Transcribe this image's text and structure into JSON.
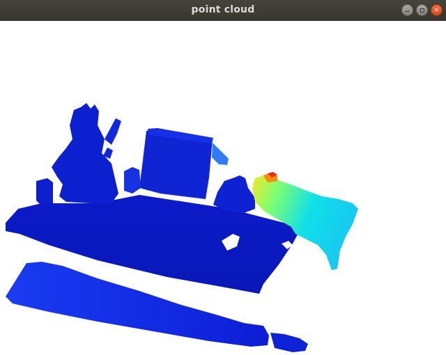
{
  "window": {
    "title": "point cloud",
    "controls": {
      "minimize_icon": "minimize-icon",
      "maximize_icon": "maximize-icon",
      "close_icon": "close-icon",
      "close_glyph": "×"
    }
  },
  "scene": {
    "colormap": "jet",
    "colors": {
      "dark_blue": "#0a1acc",
      "mid_blue": "#1530e6",
      "light_blue": "#2f6cff",
      "cyan": "#10e0e8",
      "green": "#80ff70",
      "yellow": "#f6e62a",
      "orange": "#ff8a10",
      "red": "#e83010"
    }
  }
}
